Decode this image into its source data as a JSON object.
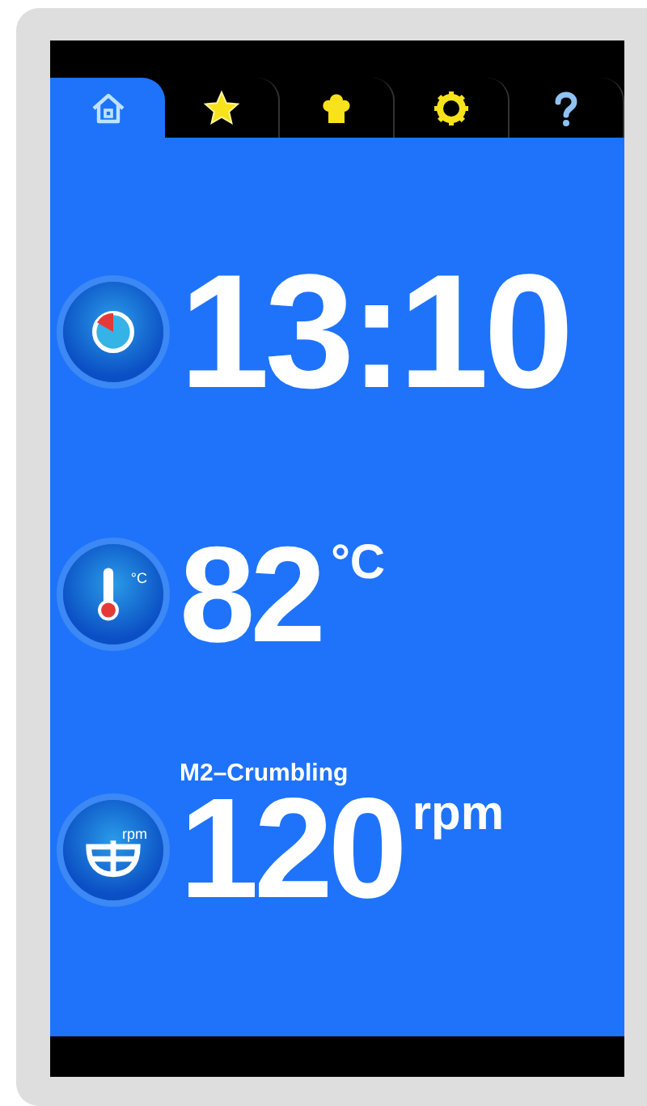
{
  "tabs": [
    {
      "kind": "home",
      "selected": true
    },
    {
      "kind": "star",
      "selected": false
    },
    {
      "kind": "chef-hat",
      "selected": false
    },
    {
      "kind": "gear",
      "selected": false
    },
    {
      "kind": "help",
      "selected": false
    }
  ],
  "readings": [
    {
      "kind": "timer",
      "value": "13:10"
    },
    {
      "kind": "temperature",
      "icon_label": "°C",
      "value": "82",
      "unit": "°C"
    },
    {
      "kind": "mixer",
      "icon_label": "rpm",
      "caption": "M2–Crumbling",
      "value": "120",
      "unit": "rpm"
    }
  ]
}
